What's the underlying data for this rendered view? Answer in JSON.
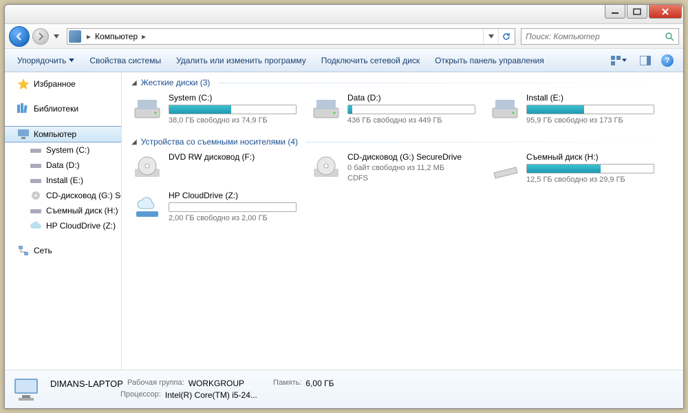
{
  "breadcrumb": {
    "location": "Компьютер"
  },
  "search": {
    "placeholder": "Поиск: Компьютер"
  },
  "toolbar": {
    "organize": "Упорядочить",
    "props": "Свойства системы",
    "uninstall": "Удалить или изменить программу",
    "map": "Подключить сетевой диск",
    "panel": "Открыть панель управления"
  },
  "sidebar": {
    "favorites": "Избранное",
    "libraries": "Библиотеки",
    "computer": "Компьютер",
    "network": "Сеть",
    "drives": [
      "System (C:)",
      "Data (D:)",
      "Install (E:)",
      "CD-дисковод (G:) Se",
      "Съемный диск (H:)",
      "HP CloudDrive (Z:)"
    ]
  },
  "sections": {
    "hdd": "Жесткие диски (3)",
    "removable": "Устройства со съемными носителями (4)"
  },
  "drives_hdd": [
    {
      "name": "System (C:)",
      "free_text": "38,0 ГБ свободно из 74,9 ГБ",
      "fill_pct": 49
    },
    {
      "name": "Data (D:)",
      "free_text": "436 ГБ свободно из 449 ГБ",
      "fill_pct": 3
    },
    {
      "name": "Install (E:)",
      "free_text": "95,9 ГБ свободно из 173 ГБ",
      "fill_pct": 45
    }
  ],
  "drives_rem": [
    {
      "name": "DVD RW дисковод (F:)",
      "free_text": "",
      "show_bar": false,
      "kind": "dvd"
    },
    {
      "name": "CD-дисковод (G:) SecureDrive",
      "free_text": "0 байт свободно из 11,2 МБ",
      "extra": "CDFS",
      "show_bar": false,
      "kind": "cd"
    },
    {
      "name": "Съемный диск (H:)",
      "free_text": "12,5 ГБ свободно из 29,9 ГБ",
      "fill_pct": 58,
      "show_bar": true,
      "kind": "usb"
    },
    {
      "name": "HP CloudDrive (Z:)",
      "free_text": "2,00 ГБ свободно из 2,00 ГБ",
      "fill_pct": 0,
      "show_bar": true,
      "kind": "cloud"
    }
  ],
  "details": {
    "name": "DIMANS-LAPTOP",
    "workgroup_label": "Рабочая группа:",
    "workgroup": "WORKGROUP",
    "memory_label": "Память:",
    "memory": "6,00 ГБ",
    "cpu_label": "Процессор:",
    "cpu": "Intel(R) Core(TM) i5-24..."
  }
}
